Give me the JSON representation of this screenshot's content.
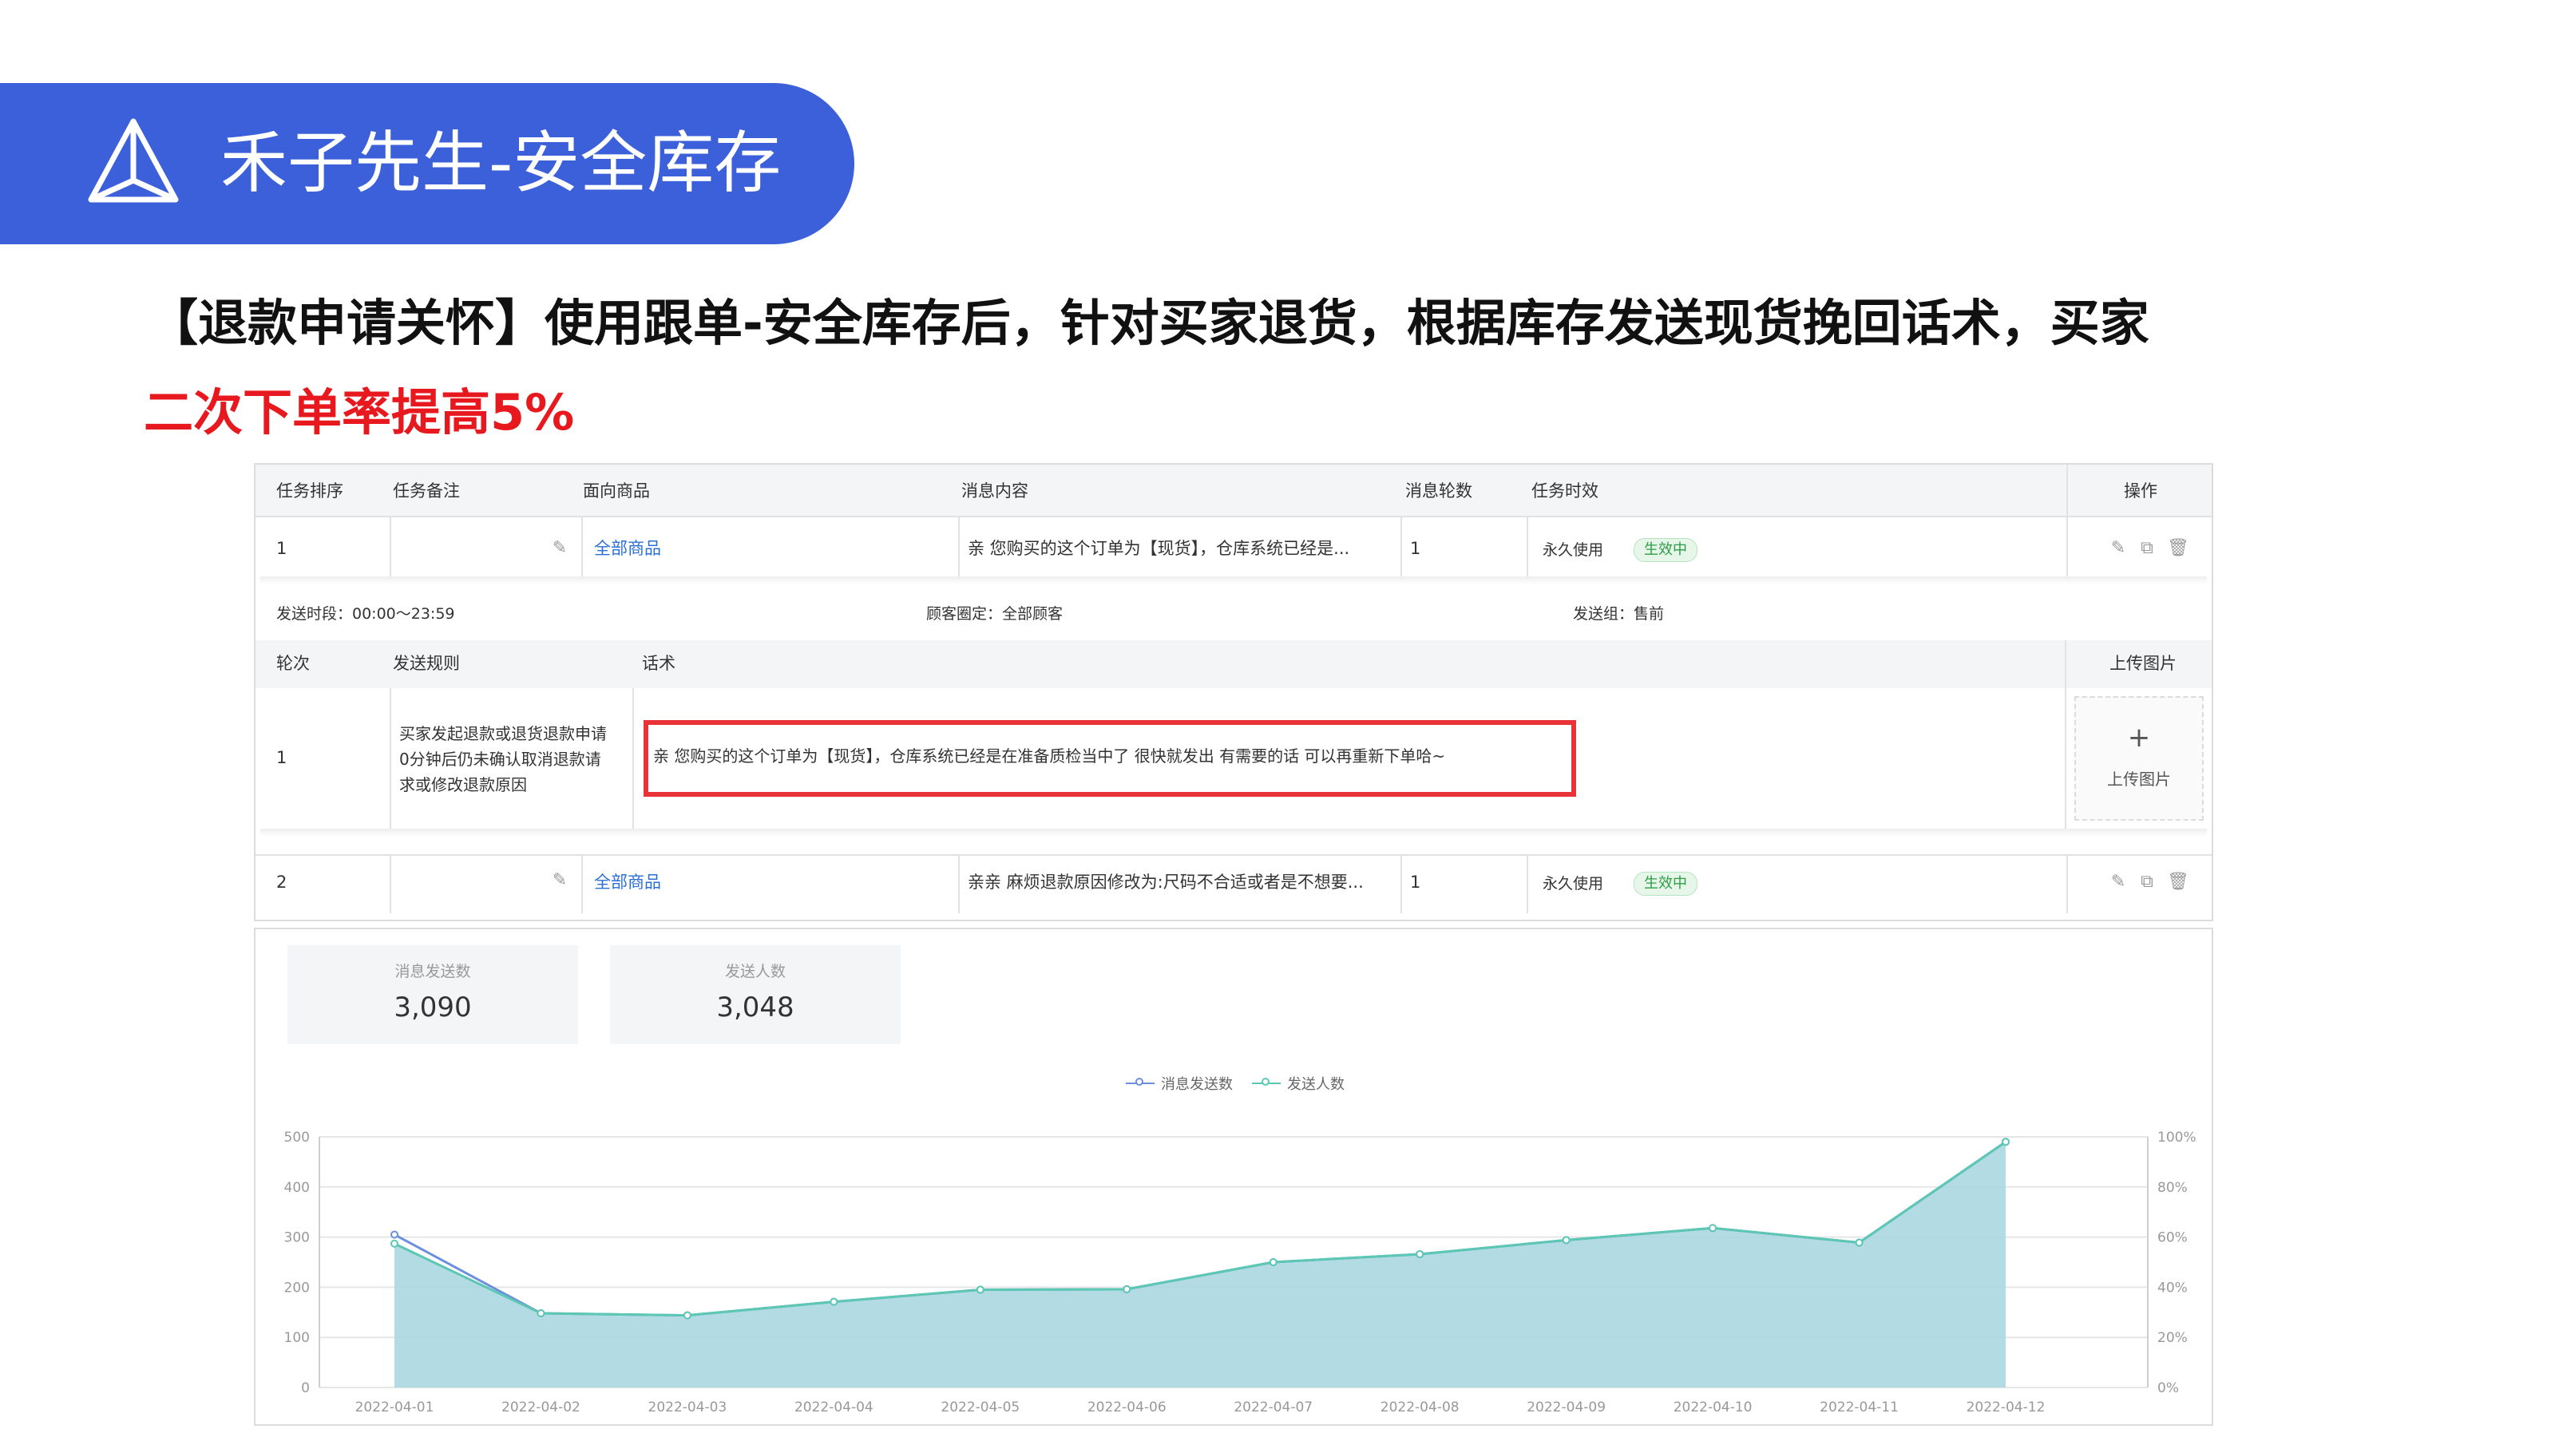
{
  "banner": {
    "title": "禾子先生-安全库存",
    "icon": "pyramid-icon"
  },
  "headline": {
    "line1": "【退款申请关怀】使用跟单-安全库存后，针对买家退货，根据库存发送现货挽回话术，买家",
    "line2": "二次下单率提高5%"
  },
  "task_table": {
    "headers": [
      "任务排序",
      "任务备注",
      "面向商品",
      "消息内容",
      "消息轮数",
      "任务时效",
      "操作"
    ],
    "rows": [
      {
        "order": "1",
        "goods": "全部商品",
        "content": "亲 您购买的这个订单为【现货】，仓库系统已经是...",
        "rounds": "1",
        "validity": "永久使用",
        "status": "生效中"
      },
      {
        "order": "2",
        "goods": "全部商品",
        "content": "亲亲 麻烦退款原因修改为:尺码不合适或者是不想要...",
        "rounds": "1",
        "validity": "永久使用",
        "status": "生效中"
      }
    ],
    "detail": {
      "send_period": "发送时段：00:00～23:59",
      "customer_scope": "顾客圈定：全部顾客",
      "send_group": "发送组：售前",
      "sub_headers": [
        "轮次",
        "发送规则",
        "话术",
        "上传图片"
      ],
      "round": "1",
      "rule_lines": [
        "买家发起退款或退货退款申请",
        "0分钟后仍未确认取消退款请",
        "求或修改退款原因"
      ],
      "script": "亲 您购买的这个订单为【现货】，仓库系统已经是在准备质检当中了 很快就发出 有需要的话 可以再重新下单哈~",
      "upload_plus": "+",
      "upload_label": "上传图片"
    }
  },
  "stats": [
    {
      "label": "消息发送数",
      "value": "3,090"
    },
    {
      "label": "发送人数",
      "value": "3,048"
    }
  ],
  "chart_data": {
    "type": "line",
    "x": [
      "2022-04-01",
      "2022-04-02",
      "2022-04-03",
      "2022-04-04",
      "2022-04-05",
      "2022-04-06",
      "2022-04-07",
      "2022-04-08",
      "2022-04-09",
      "2022-04-10",
      "2022-04-11",
      "2022-04-12"
    ],
    "series": [
      {
        "name": "消息发送数",
        "color": "#6b8fde",
        "values": [
          305,
          148,
          144,
          171,
          195,
          196,
          250,
          266,
          294,
          318,
          289,
          490
        ]
      },
      {
        "name": "发送人数",
        "color": "#5cc8b4",
        "values": [
          287,
          148,
          144,
          171,
          195,
          196,
          250,
          266,
          294,
          318,
          289,
          490
        ]
      }
    ],
    "ylim": [
      0,
      500
    ],
    "yticks": [
      "0",
      "100",
      "200",
      "300",
      "400",
      "500"
    ],
    "y2ticks": [
      "0%",
      "20%",
      "40%",
      "60%",
      "80%",
      "100%"
    ],
    "area_color": "#a6d5de",
    "grid": true,
    "legend_position": "top-center"
  }
}
